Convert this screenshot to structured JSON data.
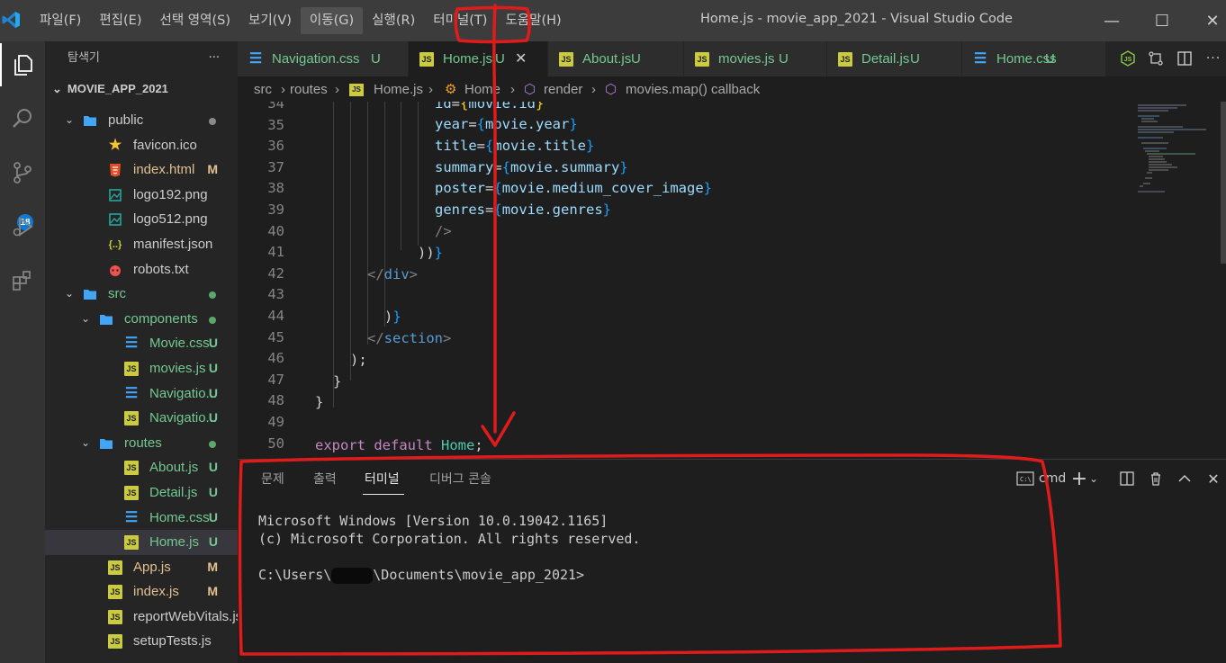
{
  "titlebar": {
    "menu": [
      "파일(F)",
      "편집(E)",
      "선택 영역(S)",
      "보기(V)",
      "이동(G)",
      "실행(R)",
      "터미널(T)",
      "도움말(H)"
    ],
    "title": "Home.js - movie_app_2021 - Visual Studio Code",
    "minimize": "—",
    "maximize": "☐",
    "close": "✕"
  },
  "activity": {
    "scm_badge": "18"
  },
  "sidebar": {
    "header": "탐색기",
    "more": "···",
    "root": "MOVIE_APP_2021",
    "items": [
      {
        "label": "public",
        "type": "folder",
        "status": "dot-gray"
      },
      {
        "label": "favicon.ico",
        "type": "star",
        "status": ""
      },
      {
        "label": "index.html",
        "type": "html",
        "status": "M"
      },
      {
        "label": "logo192.png",
        "type": "image",
        "status": ""
      },
      {
        "label": "logo512.png",
        "type": "image",
        "status": ""
      },
      {
        "label": "manifest.json",
        "type": "json",
        "status": ""
      },
      {
        "label": "robots.txt",
        "type": "robot",
        "status": ""
      },
      {
        "label": "src",
        "type": "folder",
        "status": "dot-green"
      },
      {
        "label": "components",
        "type": "folder",
        "status": "dot-green"
      },
      {
        "label": "Movie.css",
        "type": "css",
        "status": "U"
      },
      {
        "label": "movies.js",
        "type": "js",
        "status": "U"
      },
      {
        "label": "Navigatio...",
        "type": "css",
        "status": "U"
      },
      {
        "label": "Navigatio...",
        "type": "js",
        "status": "U"
      },
      {
        "label": "routes",
        "type": "folder",
        "status": "dot-green"
      },
      {
        "label": "About.js",
        "type": "js",
        "status": "U"
      },
      {
        "label": "Detail.js",
        "type": "js",
        "status": "U"
      },
      {
        "label": "Home.css",
        "type": "css",
        "status": "U"
      },
      {
        "label": "Home.js",
        "type": "js",
        "status": "U"
      },
      {
        "label": "App.js",
        "type": "js",
        "status": "M"
      },
      {
        "label": "index.js",
        "type": "js",
        "status": "M"
      },
      {
        "label": "reportWebVitals.js",
        "type": "js",
        "status": ""
      },
      {
        "label": "setupTests.js",
        "type": "js",
        "status": ""
      }
    ]
  },
  "tabs": [
    {
      "label": "Navigation.css",
      "status": "U",
      "type": "css"
    },
    {
      "label": "Home.js",
      "status": "U",
      "type": "js",
      "close": "✕"
    },
    {
      "label": "About.js",
      "status": "U",
      "type": "js"
    },
    {
      "label": "movies.js",
      "status": "U",
      "type": "js"
    },
    {
      "label": "Detail.js",
      "status": "U",
      "type": "js"
    },
    {
      "label": "Home.css",
      "status": "U",
      "type": "css"
    }
  ],
  "breadcrumb": [
    "src",
    "routes",
    "Home.js",
    "Home",
    "render",
    "movies.map() callback"
  ],
  "editor": {
    "lines": [
      {
        "n": "34"
      },
      {
        "n": "35"
      },
      {
        "n": "36"
      },
      {
        "n": "37"
      },
      {
        "n": "38"
      },
      {
        "n": "39"
      },
      {
        "n": "40"
      },
      {
        "n": "41"
      },
      {
        "n": "42"
      },
      {
        "n": "43"
      },
      {
        "n": "44"
      },
      {
        "n": "45"
      },
      {
        "n": "46"
      },
      {
        "n": "47"
      },
      {
        "n": "48"
      },
      {
        "n": "49"
      },
      {
        "n": "50"
      }
    ],
    "code": {
      "l34_attr": "id",
      "l34_val": "movie.id",
      "l35_attr": "year",
      "l35_val": "movie.year",
      "l36_attr": "title",
      "l36_val": "movie.title",
      "l37_attr": "summary",
      "l37_val": "movie.summary",
      "l38_attr": "poster",
      "l38_val": "movie.medium_cover_image",
      "l39_attr": "genres",
      "l39_val": "movie.genres",
      "l40": "/>",
      "l41": "))}",
      "l42_tag": "div",
      "l44": ")}",
      "l45_tag": "section",
      "l46": ");",
      "l47": "}",
      "l48": "}",
      "l50_kw": "export default",
      "l50_name": "Home",
      "l50_end": ";"
    }
  },
  "panel": {
    "tabs": [
      "문제",
      "출력",
      "터미널",
      "디버그 콘솔"
    ],
    "active_tab": "터미널",
    "shell": "cmd",
    "terminal": {
      "line1": "Microsoft Windows [Version 10.0.19042.1165]",
      "line2": "(c) Microsoft Corporation. All rights reserved.",
      "prompt_pre": "C:\\Users\\",
      "prompt_post": "\\Documents\\movie_app_2021>"
    }
  },
  "colors": {
    "annotation": "#e01b1b",
    "js": "#cbcb41",
    "css": "#42a5f5",
    "untracked": "#73c991",
    "modified": "#e2c08d"
  }
}
